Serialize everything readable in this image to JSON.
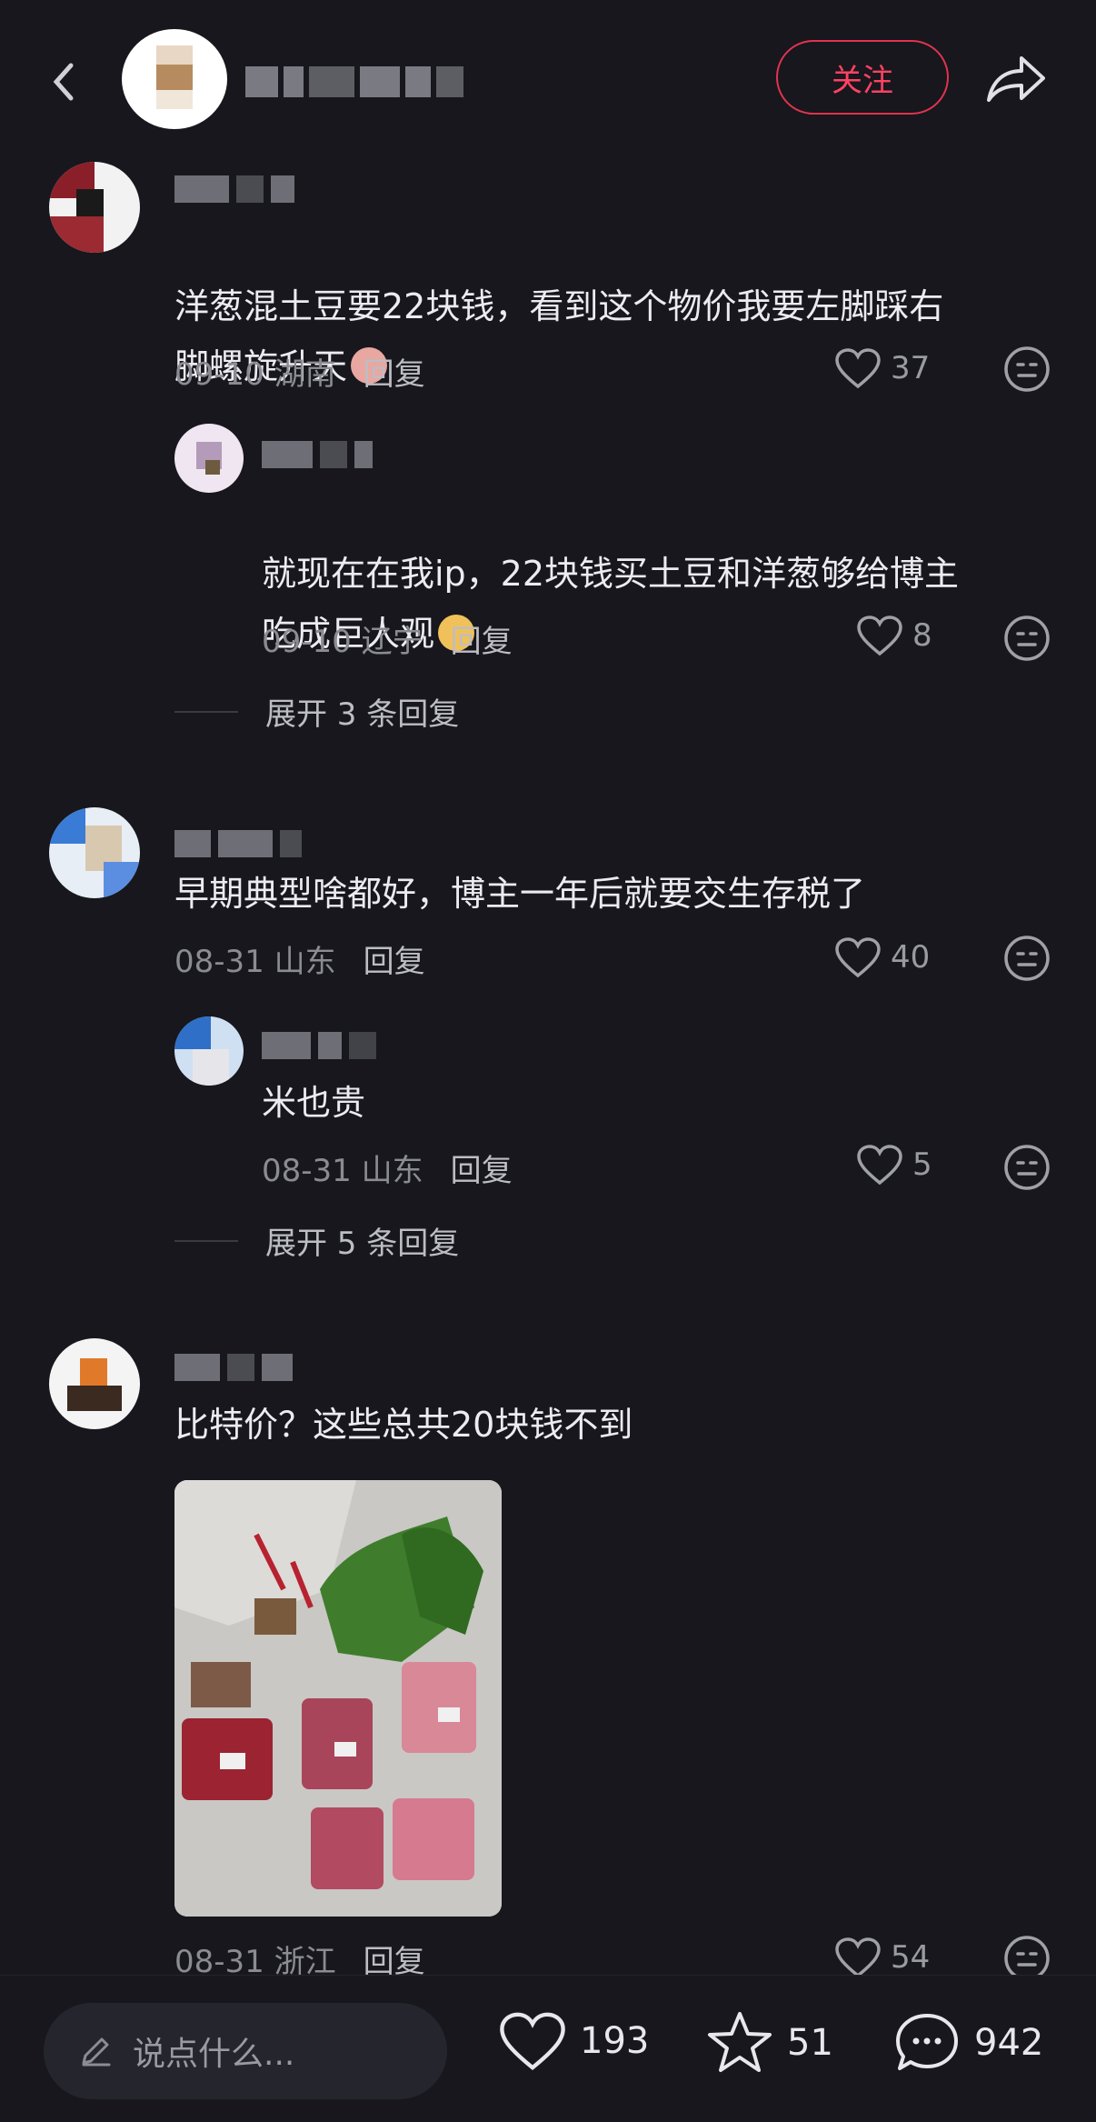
{
  "header": {
    "follow_label": "关注"
  },
  "comments": [
    {
      "text": "洋葱混土豆要22块钱，看到这个物价我要左脚踩右\n脚螺旋升天",
      "date": "09-10",
      "location": "湖南",
      "reply_label": "回复",
      "likes": "37",
      "replies": [
        {
          "text": "就现在在我ip，22块钱买土豆和洋葱够给博主\n吃成巨人观",
          "date": "09-10",
          "location": "辽宁",
          "reply_label": "回复",
          "likes": "8"
        }
      ],
      "expand_label": "展开 3 条回复"
    },
    {
      "text": "早期典型啥都好，博主一年后就要交生存税了",
      "date": "08-31",
      "location": "山东",
      "reply_label": "回复",
      "likes": "40",
      "replies": [
        {
          "text": "米也贵",
          "date": "08-31",
          "location": "山东",
          "reply_label": "回复",
          "likes": "5"
        }
      ],
      "expand_label": "展开 5 条回复"
    },
    {
      "text": "比特价？这些总共20块钱不到",
      "date": "08-31",
      "location": "浙江",
      "reply_label": "回复",
      "likes": "54"
    }
  ],
  "bottom": {
    "input_placeholder": "说点什么...",
    "likes": "193",
    "favorites": "51",
    "comments": "942"
  },
  "colors": {
    "background": "#17171d",
    "follow_accent": "#e0334f",
    "muted_text": "#8b8b93"
  }
}
